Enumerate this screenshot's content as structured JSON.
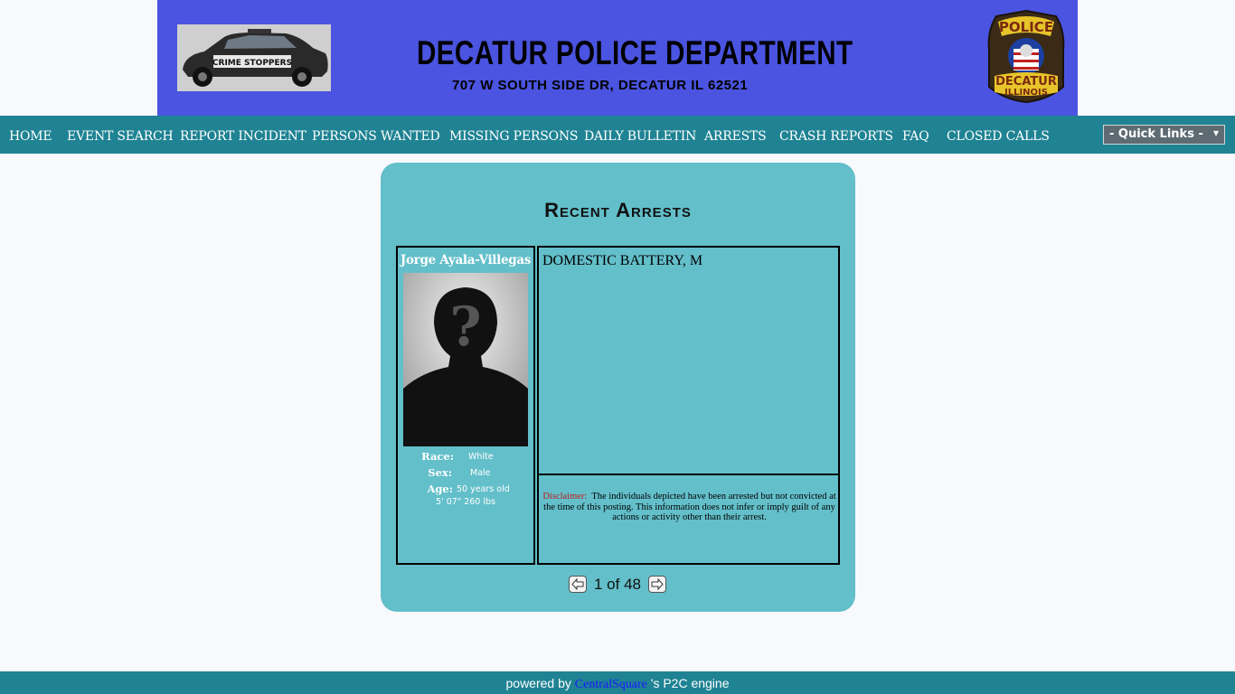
{
  "header": {
    "title": "DECATUR POLICE DEPARTMENT",
    "address": "707 W SOUTH SIDE DR, DECATUR IL 62521",
    "car_text": "CRIME STOPPERS",
    "badge_top": "POLICE",
    "badge_bottom_1": "DECATUR",
    "badge_bottom_2": "ILLINOIS"
  },
  "nav": {
    "items": [
      {
        "label": "HOME"
      },
      {
        "label": "EVENT SEARCH"
      },
      {
        "label": "REPORT INCIDENT"
      },
      {
        "label": "PERSONS WANTED"
      },
      {
        "label": "MISSING PERSONS"
      },
      {
        "label": "DAILY BULLETIN"
      },
      {
        "label": "ARRESTS"
      },
      {
        "label": "CRASH REPORTS"
      },
      {
        "label": "FAQ"
      },
      {
        "label": "CLOSED CALLS"
      }
    ],
    "quick_links": "- Quick Links -"
  },
  "arrests": {
    "title": "Recent Arrests",
    "person": {
      "name": "Jorge Ayala-Villegas",
      "race_label": "Race:",
      "race": "White",
      "sex_label": "Sex:",
      "sex": "Male",
      "age_label": "Age:",
      "age": "50 years old",
      "height_weight": "5' 07\" 260 lbs"
    },
    "charge": "DOMESTIC BATTERY, M",
    "disclaimer_label": "Disclaimer:",
    "disclaimer_text": "The individuals depicted have been arrested but not convicted at the time of this posting.   This information does not infer or imply guilt of any actions or activity other than their arrest.",
    "pager": "1 of 48"
  },
  "footer": {
    "prefix": "powered by",
    "link": "CentralSquare",
    "suffix": "'s P2C engine"
  }
}
